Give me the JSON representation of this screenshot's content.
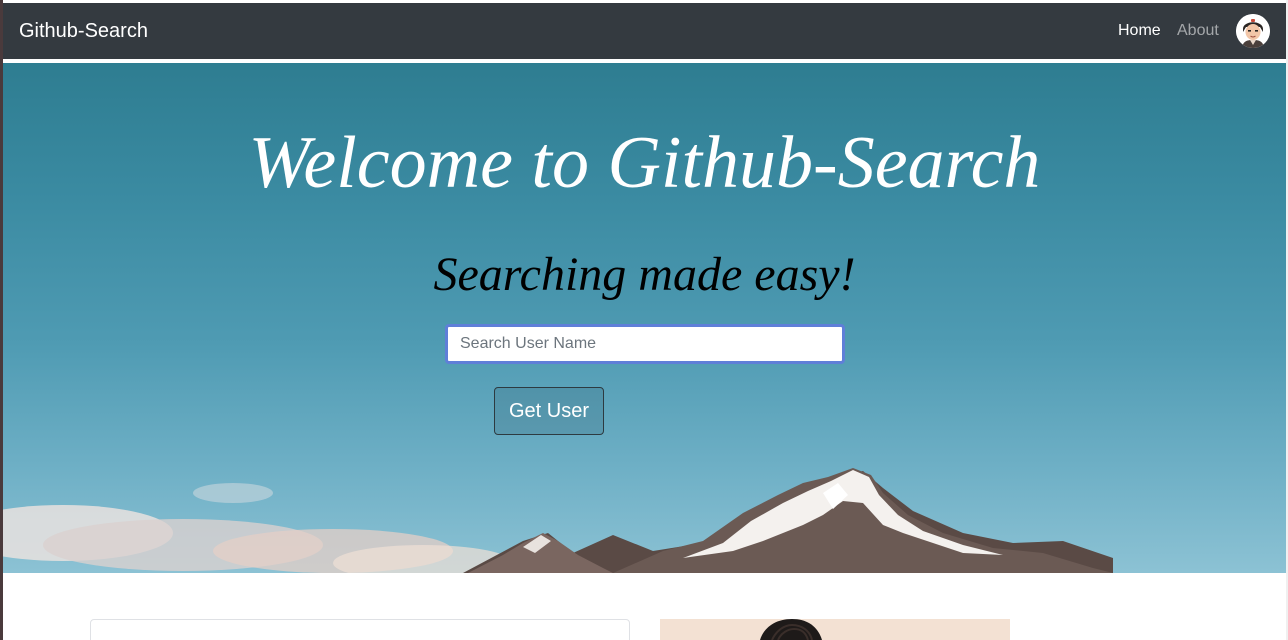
{
  "navbar": {
    "brand": "Github-Search",
    "links": [
      {
        "label": "Home",
        "active": true
      },
      {
        "label": "About",
        "active": false
      }
    ],
    "avatar_icon": "user-avatar-icon"
  },
  "hero": {
    "title": "Welcome to Github-Search",
    "subtitle": "Searching made easy!",
    "search": {
      "value": "",
      "placeholder": "Search User Name"
    },
    "submit_label": "Get User"
  },
  "colors": {
    "navbar_bg": "#343a40",
    "sky_top": "#2e7d91",
    "sky_bottom": "#8cc2d4",
    "input_focus_border": "#5f7fd8",
    "profile_card_bg": "#f3e1d3"
  }
}
